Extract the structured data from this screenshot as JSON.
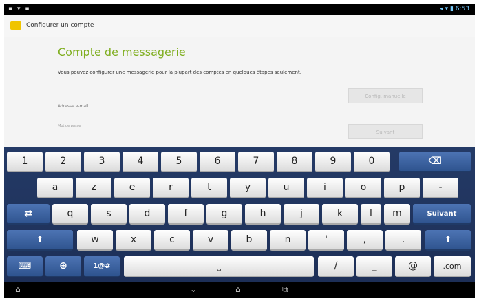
{
  "status_bar": {
    "left": "▪ ▾ ▪",
    "right": "◂ ▾ ▮ 6:53"
  },
  "action_bar": {
    "title": "Configurer un compte"
  },
  "content": {
    "title": "Compte de messagerie",
    "description": "Vous pouvez configurer une messagerie pour la plupart des comptes en quelques étapes seulement.",
    "email_label": "Adresse e-mail",
    "email_value": "",
    "password_label": "Mot de passe",
    "manual_button": "Config. manuelle",
    "next_button": "Suivant"
  },
  "keyboard": {
    "row1": [
      "1",
      "2",
      "3",
      "4",
      "5",
      "6",
      "7",
      "8",
      "9",
      "0"
    ],
    "backspace": "⌫",
    "row2": [
      "a",
      "z",
      "e",
      "r",
      "t",
      "y",
      "u",
      "i",
      "o",
      "p",
      "-"
    ],
    "row3": [
      "q",
      "s",
      "d",
      "f",
      "g",
      "h",
      "j",
      "k",
      "l",
      "m"
    ],
    "next_label": "Suivant",
    "row4": [
      "w",
      "x",
      "c",
      "v",
      "b",
      "n",
      "'",
      ",",
      "."
    ],
    "shift": "⬆",
    "switch_icon": "⇄",
    "keyboard_icon": "⌨",
    "globe_icon": "⊕",
    "sym_label": "1@#",
    "space_label": "⎵",
    "bottom": [
      "/",
      "_",
      "@",
      ".com"
    ]
  },
  "nav_bar": {
    "icons": [
      "⌂",
      "⌄",
      "⌂",
      "⧉"
    ]
  },
  "colors": {
    "accent_green": "#7fae1f",
    "keyboard_bg": "#1d2f57",
    "fn_key": "#2f548f",
    "input_underline": "#34a6c8"
  }
}
